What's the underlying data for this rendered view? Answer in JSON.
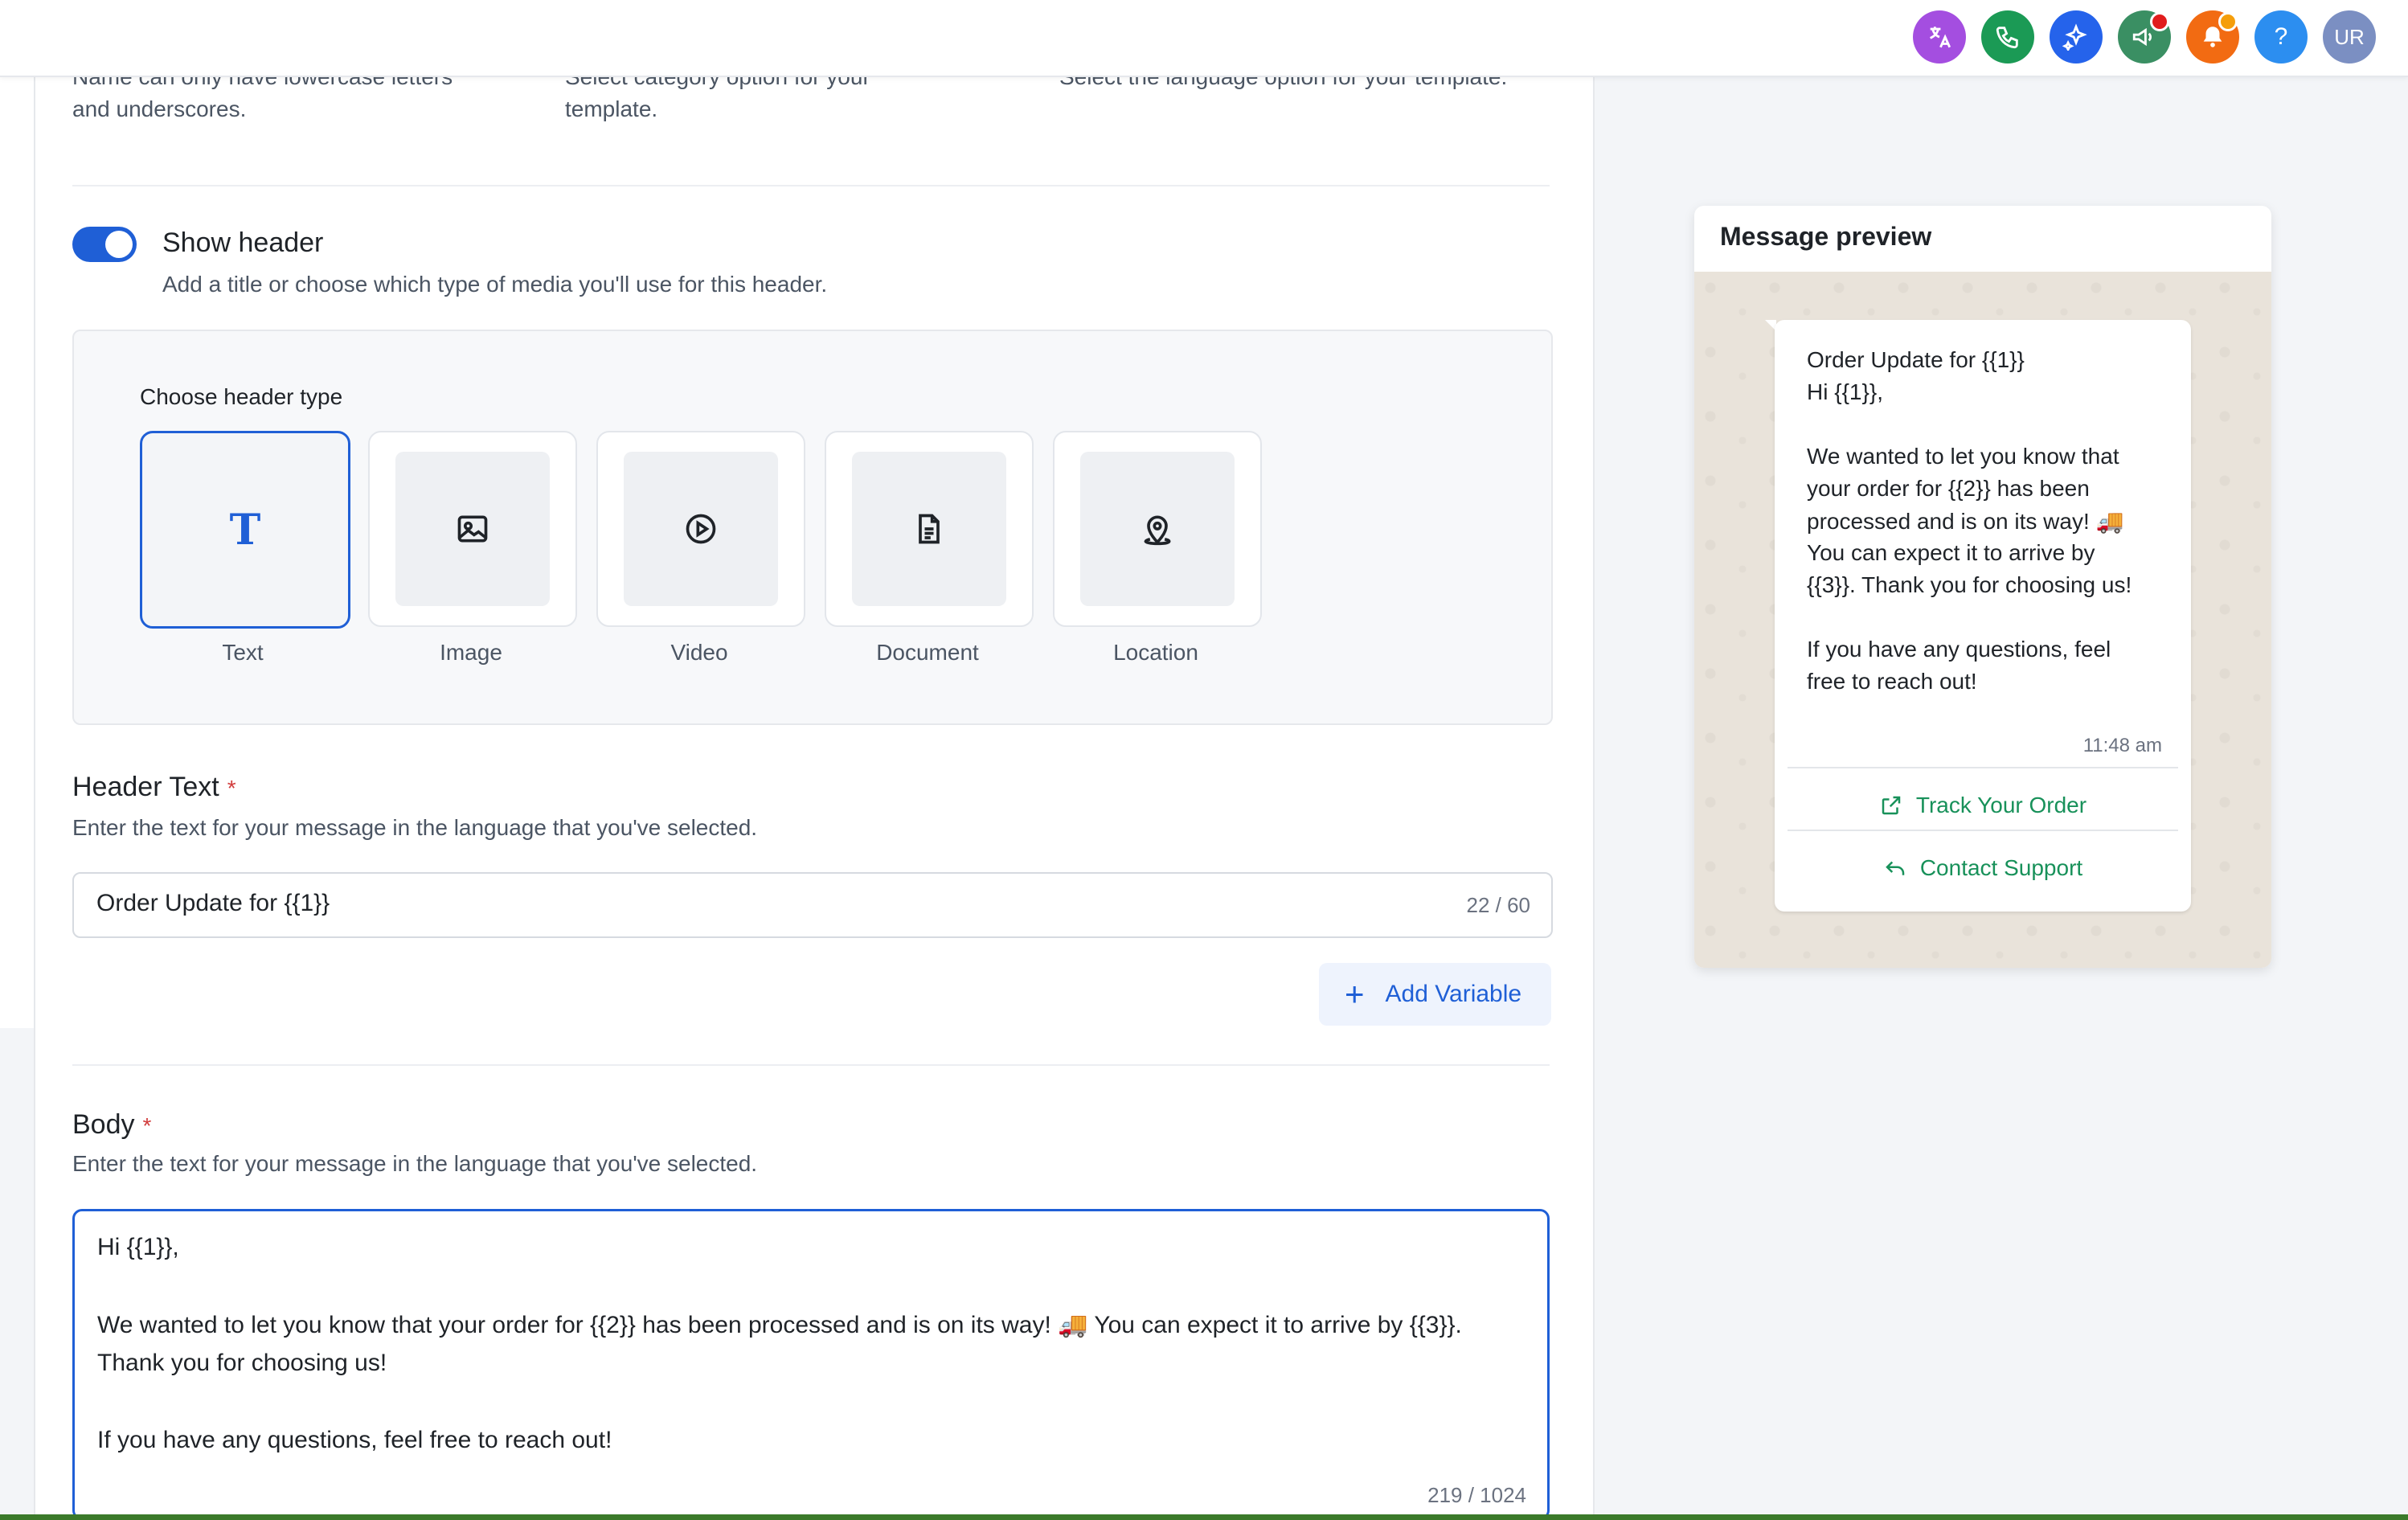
{
  "topbar": {
    "icons": [
      {
        "name": "translate-icon",
        "color": "#a44ee0"
      },
      {
        "name": "phone-icon",
        "color": "#1b9a55"
      },
      {
        "name": "sparkle-icon",
        "color": "#2563eb"
      },
      {
        "name": "megaphone-icon",
        "color": "#3a8f63",
        "badge": "#e11d1d"
      },
      {
        "name": "bell-icon",
        "color": "#f26b12",
        "badge": "#f59e0b"
      },
      {
        "name": "help-icon",
        "color": "#2c8ef0",
        "glyph": "?"
      },
      {
        "name": "avatar",
        "color": "#7b8fc2",
        "glyph": "UR"
      }
    ]
  },
  "top_hints": {
    "name_line1": "Name can only have lowercase letters",
    "name_line2": "and underscores.",
    "category_line1": "Select category option for your",
    "category_line2": "template.",
    "language_line1": "Select the language option for your template."
  },
  "header_section": {
    "toggle_label": "Show header",
    "toggle_on": true,
    "description": "Add a title or choose which type of media you'll use for this header.",
    "choose_label": "Choose header type",
    "types": [
      {
        "label": "Text",
        "icon": "text-type-icon",
        "selected": true
      },
      {
        "label": "Image",
        "icon": "image-icon",
        "selected": false
      },
      {
        "label": "Video",
        "icon": "video-play-icon",
        "selected": false
      },
      {
        "label": "Document",
        "icon": "document-icon",
        "selected": false
      },
      {
        "label": "Location",
        "icon": "location-pin-icon",
        "selected": false
      }
    ]
  },
  "header_text": {
    "title": "Header Text",
    "required_mark": "*",
    "description": "Enter the text for your message in the language that you've selected.",
    "value": "Order Update for {{1}}",
    "counter": "22 / 60",
    "add_variable_label": "Add Variable"
  },
  "body": {
    "title": "Body",
    "required_mark": "*",
    "description": "Enter the text for your message in the language that you've selected.",
    "lines": [
      "Hi {{1}},",
      "We wanted to let you know that your order for {{2}} has been processed and is on its way! 🚚 You can expect it to arrive by {{3}}.",
      "Thank you for choosing us!",
      "If you have any questions, feel free to reach out!"
    ],
    "counter": "219 / 1024"
  },
  "preview": {
    "title": "Message preview",
    "header": "Order Update for {{1}}",
    "lines": [
      "Hi {{1}},",
      "We wanted to let you know that",
      "your order for {{2}} has been",
      "processed and is on its way! 🚚",
      "You can expect it to arrive by",
      "{{3}}. Thank you for choosing us!",
      "If you have any questions, feel",
      "free to reach out!"
    ],
    "time": "11:48 am",
    "buttons": [
      {
        "label": "Track Your Order",
        "icon": "external-link-icon"
      },
      {
        "label": "Contact Support",
        "icon": "reply-icon"
      }
    ]
  },
  "colors": {
    "accent": "#1f5fd6",
    "whatsapp_green": "#18915a",
    "required": "#d13c3c"
  }
}
